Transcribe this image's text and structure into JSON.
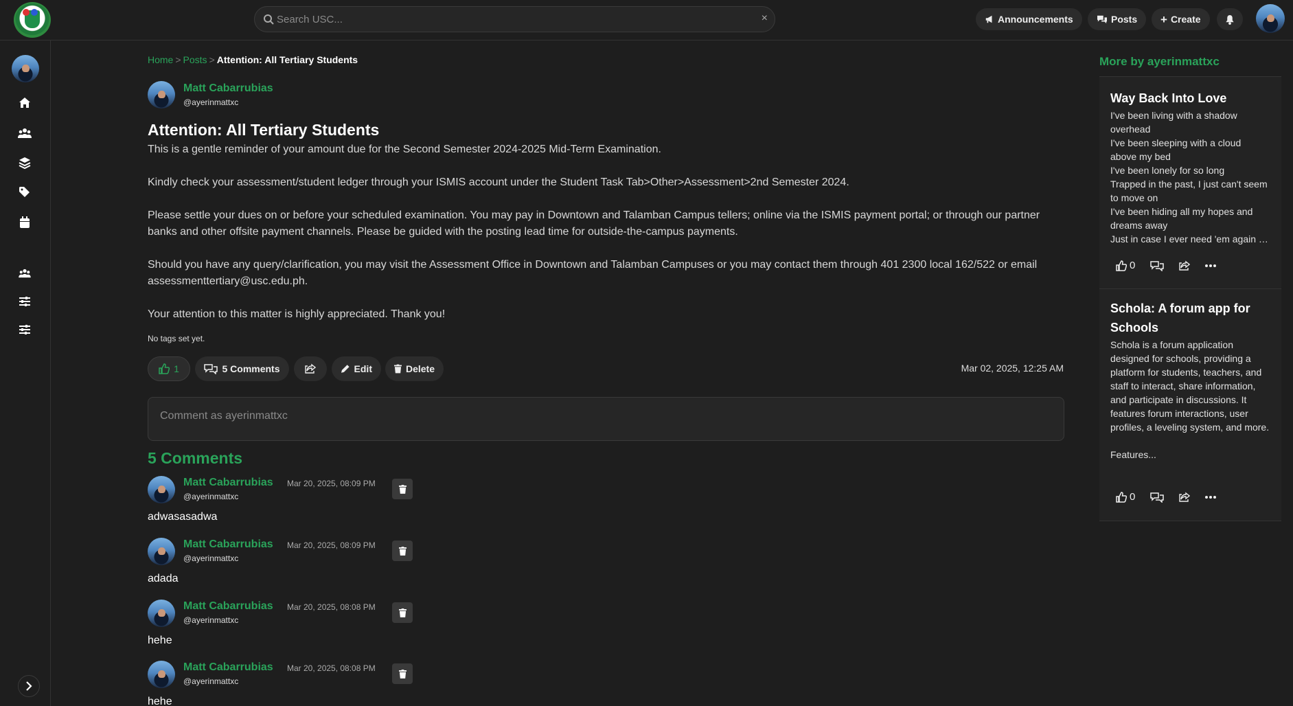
{
  "header": {
    "search_placeholder": "Search USC...",
    "clear_icon": "×",
    "announcements_label": "Announcements",
    "posts_label": "Posts",
    "create_label": "Create"
  },
  "breadcrumb": {
    "home": "Home",
    "posts": "Posts",
    "current": "Attention: All Tertiary Students",
    "separator": ">"
  },
  "post": {
    "author_name": "Matt Cabarrubias",
    "author_handle": "@ayerinmattxc",
    "title": "Attention: All Tertiary Students",
    "paragraphs": [
      "This is a gentle reminder of your amount due for the Second Semester 2024-2025 Mid-Term Examination.",
      "Kindly check your assessment/student ledger through your ISMIS account under the Student Task Tab>Other>Assessment>2nd Semester 2024.",
      "Please settle your dues on or before your scheduled examination. You may pay in Downtown and Talamban Campus tellers; online via the ISMIS payment portal; or through our partner banks and other offsite payment channels. Please be guided with the posting lead time for outside-the-campus payments.",
      "Should you have any query/clarification, you may visit the Assessment Office in Downtown and Talamban Campuses or you may contact them through 401 2300 local 162/522 or email assessmenttertiary@usc.edu.ph.",
      "Your attention to this matter is highly appreciated. Thank you!"
    ],
    "tags_text": "No tags set yet.",
    "like_count": "1",
    "comments_label": "5 Comments",
    "edit_label": "Edit",
    "delete_label": "Delete",
    "date": "Mar 02, 2025, 12:25 AM"
  },
  "comment_input": {
    "placeholder": "Comment as ayerinmattxc"
  },
  "comments": {
    "heading": "5 Comments",
    "items": [
      {
        "name": "Matt Cabarrubias",
        "handle": "@ayerinmattxc",
        "date": "Mar 20, 2025, 08:09 PM",
        "text": "adwasasadwa"
      },
      {
        "name": "Matt Cabarrubias",
        "handle": "@ayerinmattxc",
        "date": "Mar 20, 2025, 08:09 PM",
        "text": "adada"
      },
      {
        "name": "Matt Cabarrubias",
        "handle": "@ayerinmattxc",
        "date": "Mar 20, 2025, 08:08 PM",
        "text": "hehe"
      },
      {
        "name": "Matt Cabarrubias",
        "handle": "@ayerinmattxc",
        "date": "Mar 20, 2025, 08:08 PM",
        "text": "hehe"
      }
    ]
  },
  "more_by": {
    "heading": "More by ayerinmattxc",
    "cards": [
      {
        "title": "Way Back Into Love",
        "lines": [
          "I've been living with a shadow overhead",
          "I've been sleeping with a cloud above my bed",
          "I've been lonely for so long",
          "Trapped in the past, I just can't seem to move on",
          "I've been hiding all my hopes and dreams away",
          "Just in case I ever need 'em again someday"
        ],
        "likes": "0"
      },
      {
        "title": "Schola: A forum app for Schools",
        "lines": [
          "Schola is a forum application designed for schools, providing a platform for students, teachers, and staff to interact, share information, and participate in discussions. It features forum interactions, user profiles, a leveling system, and more.",
          "Features..."
        ],
        "likes": "0"
      }
    ]
  },
  "colors": {
    "accent": "#2aa35a",
    "background": "#1e1e1e",
    "surface": "#2c2c2c"
  }
}
